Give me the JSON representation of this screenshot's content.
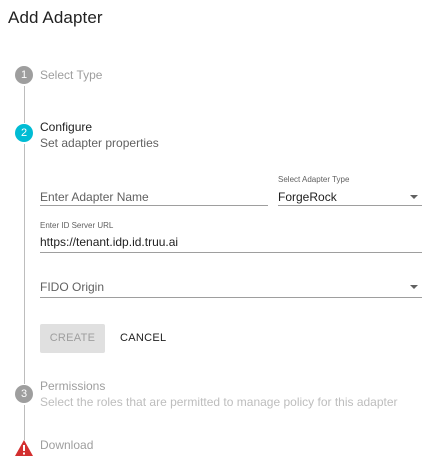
{
  "dialog": {
    "title": "Add Adapter"
  },
  "steps": [
    {
      "number": "1",
      "title": "Select Type",
      "subtitle": ""
    },
    {
      "number": "2",
      "title": "Configure",
      "subtitle": "Set adapter properties"
    },
    {
      "number": "3",
      "title": "Permissions",
      "subtitle": "Select the roles that are permitted to manage policy for this adapter"
    },
    {
      "number": "",
      "title": "Download",
      "subtitle": ""
    }
  ],
  "form": {
    "adapter_name": {
      "placeholder": "Enter Adapter Name",
      "value": ""
    },
    "adapter_type": {
      "label": "Select Adapter Type",
      "value": "ForgeRock"
    },
    "id_server_url": {
      "label": "Enter ID Server URL",
      "value": "https://tenant.idp.id.truu.ai"
    },
    "fido_origin": {
      "placeholder": "FIDO Origin",
      "value": ""
    }
  },
  "buttons": {
    "create": "CREATE",
    "cancel": "CANCEL"
  },
  "colors": {
    "active_step": "#00bcd4",
    "inactive_step": "#9e9e9e",
    "warning": "#d32f2f"
  },
  "icons": {
    "step4": "warning-icon",
    "dropdown": "caret-down-icon"
  }
}
